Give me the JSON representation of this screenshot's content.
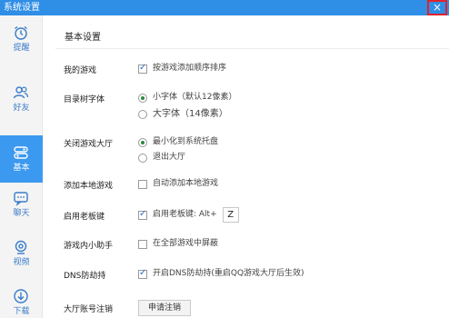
{
  "window": {
    "title": "系统设置",
    "close_glyph": "×"
  },
  "sidebar": {
    "items": [
      {
        "label": "提醒",
        "icon": "alarm-clock-icon",
        "active": false
      },
      {
        "label": "好友",
        "icon": "friends-icon",
        "active": false
      },
      {
        "label": "基本",
        "icon": "basic-settings-icon",
        "active": true
      },
      {
        "label": "聊天",
        "icon": "chat-bubble-icon",
        "active": false
      },
      {
        "label": "视频",
        "icon": "video-camera-icon",
        "active": false
      },
      {
        "label": "下载",
        "icon": "download-icon",
        "active": false
      }
    ]
  },
  "main": {
    "section_title": "基本设置",
    "rows": {
      "my_games": {
        "label": "我的游戏",
        "opt1": "按游戏添加顺序排序",
        "opt1_checked": true
      },
      "tree_font": {
        "label": "目录树字体",
        "opt1": "小字体（默认12像素）",
        "opt2": "大字体（14像素）",
        "selected": 1
      },
      "close_hall": {
        "label": "关闭游戏大厅",
        "opt1": "最小化到系统托盘",
        "opt2": "退出大厅",
        "selected": 1
      },
      "add_local": {
        "label": "添加本地游戏",
        "opt1": "自动添加本地游戏",
        "opt1_checked": false
      },
      "boss_key": {
        "label": "启用老板键",
        "opt1": "启用老板键: Alt+",
        "key": "Z",
        "opt1_checked": true
      },
      "helper": {
        "label": "游戏内小助手",
        "opt1": "在全部游戏中屏蔽",
        "opt1_checked": false
      },
      "dns": {
        "label": "DNS防劫持",
        "opt1": "开启DNS防劫持(重启QQ游戏大厅后生效)",
        "opt1_checked": true
      },
      "account_cancel": {
        "label": "大厅账号注销",
        "button": "申请注销"
      }
    }
  },
  "colors": {
    "accent": "#2f8ee6",
    "active_nav": "#3c99f0",
    "close_border": "#e0232a"
  }
}
